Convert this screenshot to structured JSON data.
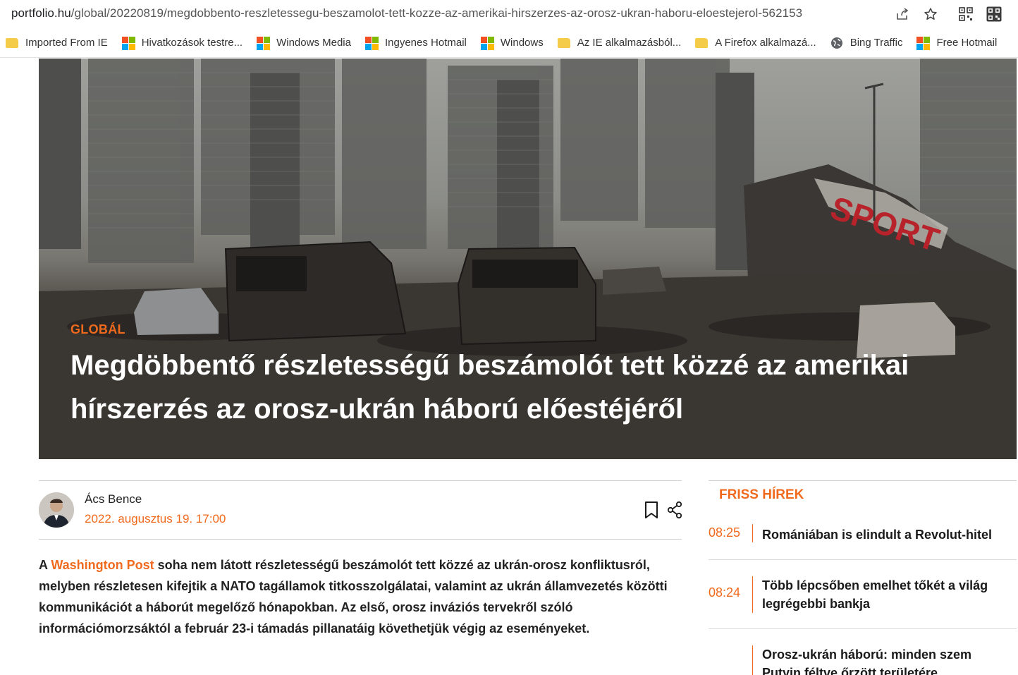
{
  "browser": {
    "url_host": "portfolio.hu",
    "url_path": "/global/20220819/megdobbento-reszletessegu-beszamolot-tett-kozze-az-amerikai-hirszerzes-az-orosz-ukran-haboru-eloestejerol-562153",
    "bookmarks": [
      {
        "label": "Imported From IE",
        "icon": "folder-icon"
      },
      {
        "label": "Hivatkozások testre...",
        "icon": "windows-logo-icon"
      },
      {
        "label": "Windows Media",
        "icon": "windows-logo-icon"
      },
      {
        "label": "Ingyenes Hotmail",
        "icon": "windows-logo-icon"
      },
      {
        "label": "Windows",
        "icon": "windows-logo-icon"
      },
      {
        "label": "Az IE alkalmazásból...",
        "icon": "folder-icon"
      },
      {
        "label": "A Firefox alkalmazá...",
        "icon": "folder-icon"
      },
      {
        "label": "Bing Traffic",
        "icon": "globe-icon"
      },
      {
        "label": "Free Hotmail",
        "icon": "windows-logo-icon"
      }
    ]
  },
  "hero": {
    "category": "GLOBÁL",
    "title": "Megdöbbentő részletességű beszámolót tett közzé az amerikai hírszerzés az orosz-ukrán háború előestéjéről",
    "sign_text": "SPORT"
  },
  "article": {
    "author": "Ács Bence",
    "date": "2022. augusztus 19. 17:00",
    "lead_prefix": "A ",
    "lead_link": "Washington Post",
    "lead_rest": " soha nem látott részletességű beszámolót tett közzé az ukrán-orosz konfliktusról, melyben részletesen kifejtik a NATO tagállamok titkosszolgálatai, valamint az ukrán államvezetés közötti kommunikációt a háborút megelőző hónapokban. Az első, orosz inváziós tervekről szóló információmorzsáktól a február 23-i támadás pillanatáig követhetjük végig az eseményeket."
  },
  "sidebar": {
    "title": "FRISS HÍREK",
    "items": [
      {
        "time": "08:25",
        "title": "Romániában is elindult a Revolut-hitel"
      },
      {
        "time": "08:24",
        "title": "Több lépcsőben emelhet tőkét a világ legrégebbi bankja"
      },
      {
        "time": "",
        "title": "Orosz-ukrán háború: minden szem Putyin féltve őrzött területére"
      }
    ]
  },
  "colors": {
    "accent": "#f06a1e",
    "bookmark_folder": "#f4cc4a"
  }
}
